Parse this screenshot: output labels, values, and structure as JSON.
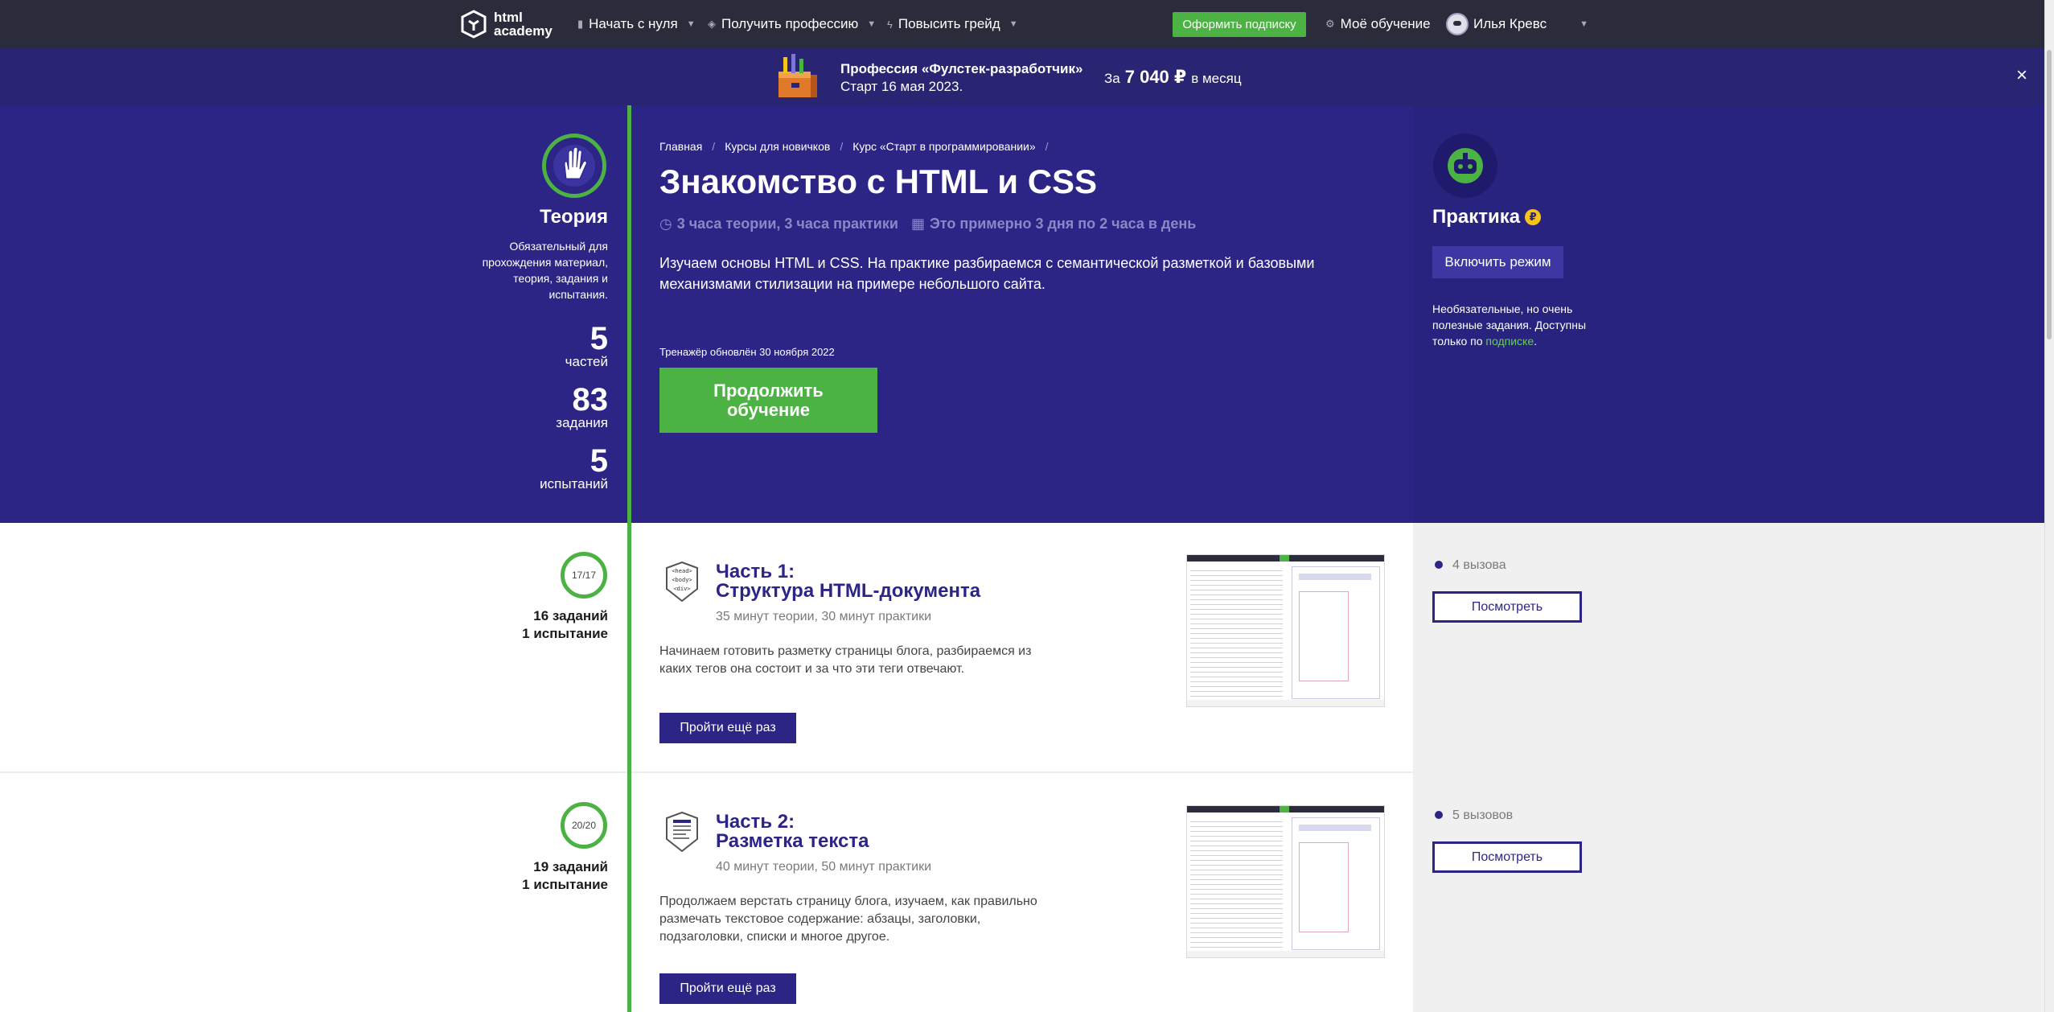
{
  "nav": {
    "logo_text_1": "html",
    "logo_text_2": "academy",
    "items": [
      {
        "label": "Начать с нуля",
        "icon": "chart-icon"
      },
      {
        "label": "Получить профессию",
        "icon": "graduation-cap-icon"
      },
      {
        "label": "Повысить грейд",
        "icon": "lightning-icon"
      }
    ],
    "subscribe": "Оформить подписку",
    "my_learning": "Моё обучение",
    "user_name": "Илья Кревс"
  },
  "promo": {
    "title": "Профессия «Фулстек-разработчик»",
    "subtitle": "Старт 16 мая 2023.",
    "price_prefix": "За",
    "price": "7 040 ₽",
    "price_suffix": "в месяц",
    "close": "×"
  },
  "theory": {
    "title": "Теория",
    "description": "Обязательный для прохождения материал, теория, задания и испытания.",
    "stats": [
      {
        "num": "5",
        "label": "частей"
      },
      {
        "num": "83",
        "label": "задания"
      },
      {
        "num": "5",
        "label": "испытаний"
      }
    ]
  },
  "hero": {
    "breadcrumb": [
      "Главная",
      "Курсы для новичков",
      "Курс «Старт в программировании»"
    ],
    "title": "Знакомство с HTML и CSS",
    "duration": "3 часа теории, 3 часа практики",
    "schedule": "Это примерно 3 дня по 2 часа в день",
    "description": "Изучаем основы HTML и CSS. На практике разбираемся с семантической разметкой и базовыми механизмами стилизации на примере небольшого сайта.",
    "updated": "Тренажёр обновлён 30 ноября 2022",
    "continue": "Продолжить обучение"
  },
  "practice": {
    "title": "Практика",
    "coin": "₽",
    "mode_button": "Включить режим",
    "description_1": "Необязательные, но очень полезные задания. Доступны только по",
    "link": "подписке",
    "description_end": "."
  },
  "chapters": [
    {
      "progress": "17/17",
      "tasks": "16 заданий",
      "trials": "1 испытание",
      "part": "Часть 1:",
      "title": "Структура HTML-документа",
      "meta": "35 минут теории, 30 минут практики",
      "description": "Начинаем готовить разметку страницы блога, разбираемся из каких тегов она состоит и за что эти теги отвечают.",
      "again": "Пройти ещё раз",
      "calls": "4 вызова",
      "view": "Посмотреть",
      "icon_lines": [
        "<head>",
        "<body>",
        "<div>"
      ]
    },
    {
      "progress": "20/20",
      "tasks": "19 заданий",
      "trials": "1 испытание",
      "part": "Часть 2:",
      "title": "Разметка текста",
      "meta": "40 минут теории, 50 минут практики",
      "description": "Продолжаем верстать страницу блога, изучаем, как правильно размечать текстовое содержание: абзацы, заголовки, подзаголовки, списки и многое другое.",
      "again": "Пройти ещё раз",
      "calls": "5 вызовов",
      "view": "Посмотреть"
    }
  ],
  "colors": {
    "nav_bg": "#2b2c3b",
    "hero_bg": "#2c2585",
    "accent_green": "#4cb244",
    "accent_yellow": "#f4c518"
  }
}
